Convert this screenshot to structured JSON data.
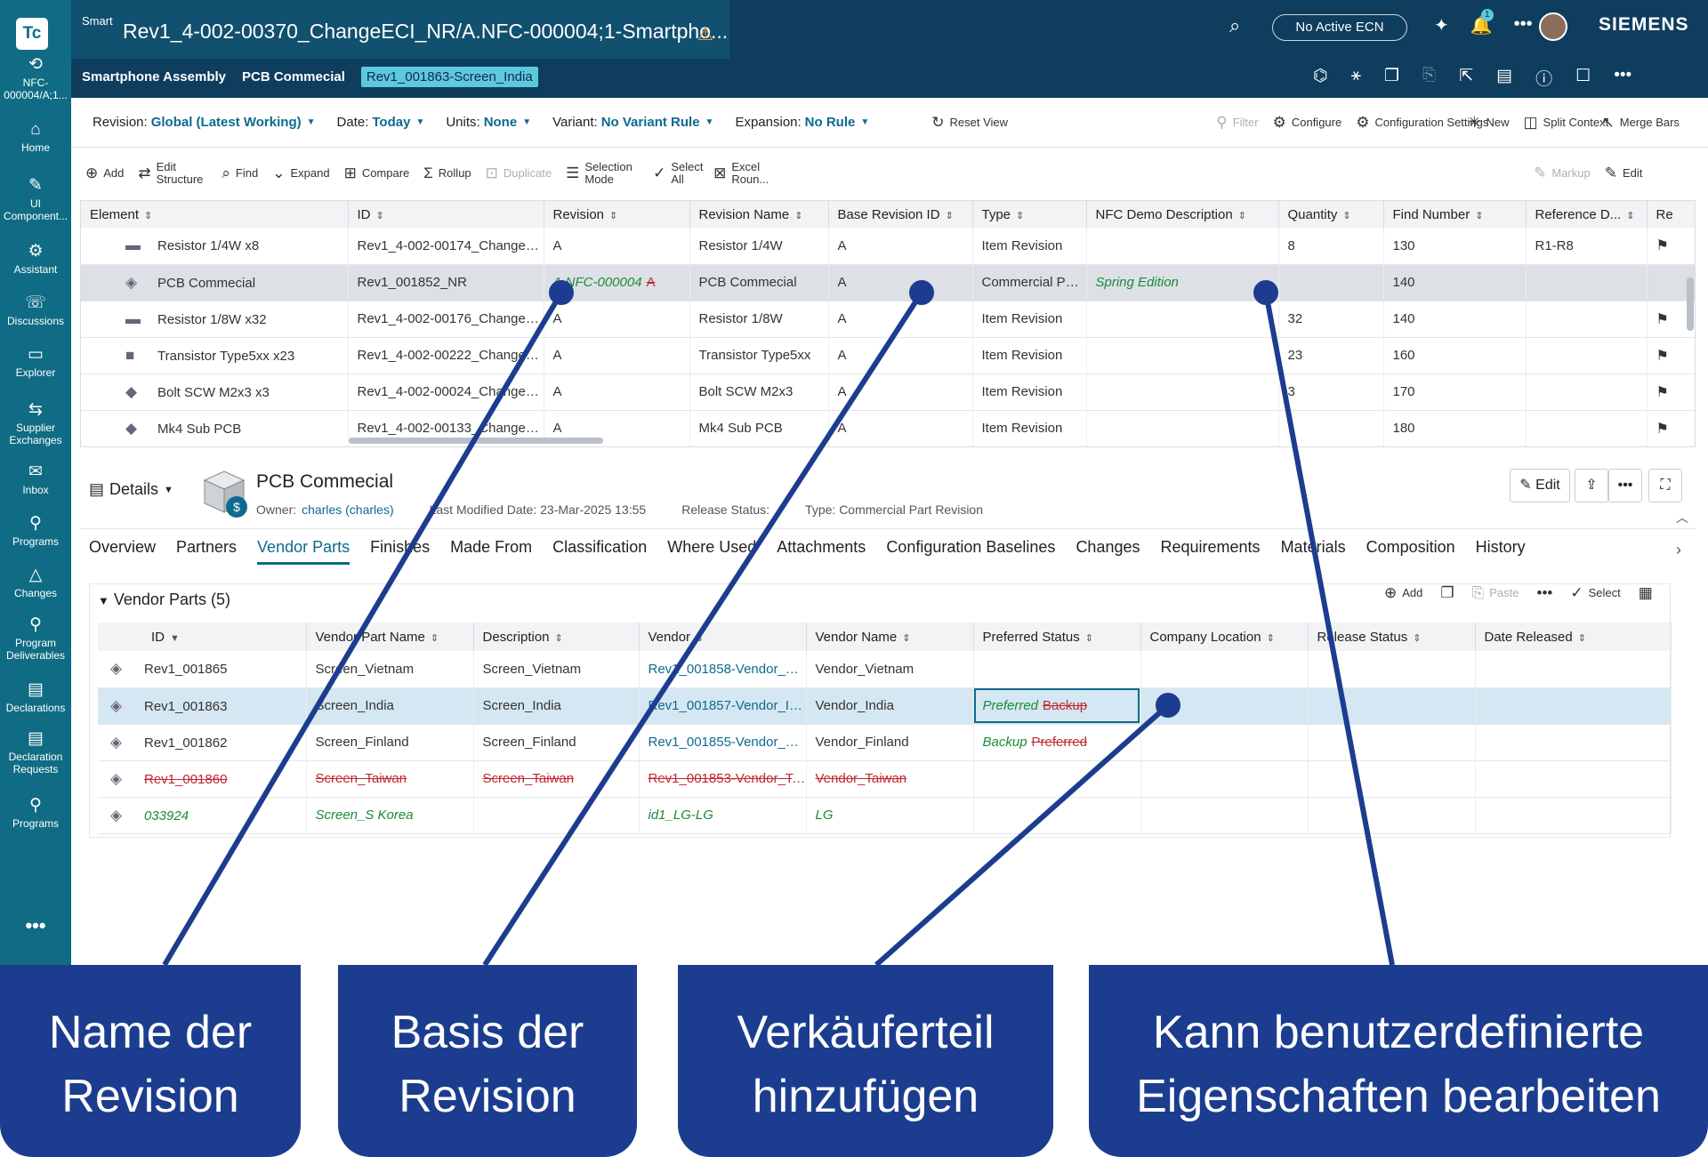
{
  "app": {
    "logo": "Tc",
    "window_title": "Rev1_4-002-00370_ChangeECI_NR/A.NFC-000004;1-Smartpho...",
    "smart_label": "Smart",
    "ecn_badge": "No Active ECN",
    "notification_count": "1",
    "brand": "SIEMENS"
  },
  "breadcrumb": {
    "items": [
      "Smartphone Assembly",
      "PCB Commecial"
    ],
    "current": "Rev1_001863-Screen_India"
  },
  "rail": {
    "items": [
      {
        "label": "NFC-000004/A;1...",
        "icon": "refresh-icon"
      },
      {
        "label": "Home",
        "icon": "home-icon"
      },
      {
        "label": "UI Component...",
        "icon": "component-icon"
      },
      {
        "label": "Assistant",
        "icon": "assistant-icon"
      },
      {
        "label": "Discussions",
        "icon": "discussions-icon"
      },
      {
        "label": "Explorer",
        "icon": "explorer-icon"
      },
      {
        "label": "Supplier Exchanges",
        "icon": "supplier-icon"
      },
      {
        "label": "Inbox",
        "icon": "inbox-icon"
      },
      {
        "label": "Programs",
        "icon": "programs-icon"
      },
      {
        "label": "Changes",
        "icon": "changes-icon"
      },
      {
        "label": "Program Deliverables",
        "icon": "deliverables-icon"
      },
      {
        "label": "Declarations",
        "icon": "declarations-icon"
      },
      {
        "label": "Declaration Requests",
        "icon": "declaration-requests-icon"
      },
      {
        "label": "Programs",
        "icon": "programs-icon"
      }
    ],
    "more": "•••"
  },
  "context": {
    "revision_label": "Revision:",
    "revision_value": "Global (Latest Working)",
    "date_label": "Date:",
    "date_value": "Today",
    "units_label": "Units:",
    "units_value": "None",
    "variant_label": "Variant:",
    "variant_value": "No Variant Rule",
    "expansion_label": "Expansion:",
    "expansion_value": "No Rule",
    "reset_view": "Reset View",
    "filter": "Filter",
    "configure": "Configure",
    "configuration_settings": "Configuration Settings",
    "new": "New",
    "split_context": "Split Context",
    "merge_bars": "Merge Bars"
  },
  "toolbar": {
    "add": "Add",
    "edit_structure": "Edit Structure",
    "find": "Find",
    "expand": "Expand",
    "compare": "Compare",
    "rollup": "Rollup",
    "duplicate": "Duplicate",
    "selection_mode": "Selection Mode",
    "select_all": "Select All",
    "excel": "Excel Roun...",
    "markup": "Markup",
    "edit": "Edit"
  },
  "grid": {
    "columns": [
      "Element",
      "ID",
      "Revision",
      "Revision Name",
      "Base Revision ID",
      "Type",
      "NFC Demo Description",
      "Quantity",
      "Find Number",
      "Reference D...",
      "Re"
    ],
    "rows": [
      {
        "element": "Resistor 1/4W x8",
        "id": "Rev1_4-002-00174_ChangeE...",
        "revision": "A",
        "rev_name": "Resistor 1/4W",
        "base": "A",
        "type": "Item Revision",
        "nfc": "",
        "qty": "8",
        "find": "130",
        "ref": "R1-R8",
        "flag": true
      },
      {
        "element": "PCB Commecial",
        "id": "Rev1_001852_NR",
        "revision": "A.NFC-000004",
        "rev_strike": "A",
        "rev_name": "PCB Commecial",
        "base": "A",
        "type": "Commercial Par...",
        "nfc": "Spring Edition",
        "qty": "",
        "find": "140",
        "ref": "",
        "flag": false,
        "selected": true
      },
      {
        "element": "Resistor 1/8W x32",
        "id": "Rev1_4-002-00176_ChangeE...",
        "revision": "A",
        "rev_name": "Resistor 1/8W",
        "base": "A",
        "type": "Item Revision",
        "nfc": "",
        "qty": "32",
        "find": "140",
        "ref": "",
        "flag": true
      },
      {
        "element": "Transistor Type5xx x23",
        "id": "Rev1_4-002-00222_ChangeE...",
        "revision": "A",
        "rev_name": "Transistor Type5xx",
        "base": "A",
        "type": "Item Revision",
        "nfc": "",
        "qty": "23",
        "find": "160",
        "ref": "",
        "flag": true
      },
      {
        "element": "Bolt SCW M2x3 x3",
        "id": "Rev1_4-002-00024_ChangeE...",
        "revision": "A",
        "rev_name": "Bolt SCW M2x3",
        "base": "A",
        "type": "Item Revision",
        "nfc": "",
        "qty": "3",
        "find": "170",
        "ref": "",
        "flag": true
      },
      {
        "element": "Mk4 Sub PCB",
        "id": "Rev1_4-002-00133_ChangeE...",
        "revision": "A",
        "rev_name": "Mk4 Sub PCB",
        "base": "A",
        "type": "Item Revision",
        "nfc": "",
        "qty": "",
        "find": "180",
        "ref": "",
        "flag": true
      }
    ]
  },
  "details": {
    "label": "Details",
    "name": "PCB Commecial",
    "owner_label": "Owner:",
    "owner": "charles (charles)",
    "modified_label": "Last Modified Date:",
    "modified": "23-Mar-2025 13:55",
    "release_label": "Release Status:",
    "type_label": "Type:",
    "type": "Commercial Part Revision",
    "edit": "Edit"
  },
  "tabs": [
    "Overview",
    "Partners",
    "Vendor Parts",
    "Finishes",
    "Made From",
    "Classification",
    "Where Used",
    "Attachments",
    "Configuration Baselines",
    "Changes",
    "Requirements",
    "Materials",
    "Composition",
    "History"
  ],
  "active_tab": "Vendor Parts",
  "vendor_parts": {
    "title": "Vendor Parts (5)",
    "add": "Add",
    "paste": "Paste",
    "select": "Select",
    "columns": [
      "ID",
      "Vendor Part Name",
      "Description",
      "Vendor",
      "Vendor Name",
      "Preferred Status",
      "Company Location",
      "Release Status",
      "Date Released"
    ],
    "rows": [
      {
        "id": "Rev1_001865",
        "part": "Screen_Vietnam",
        "desc": "Screen_Vietnam",
        "vendor": "Rev1_001858-Vendor_Vi...",
        "vname": "Vendor_Vietnam",
        "pref": "",
        "pref_strike": "",
        "style": "normal"
      },
      {
        "id": "Rev1_001863",
        "part": "Screen_India",
        "desc": "Screen_India",
        "vendor": "Rev1_001857-Vendor_In...",
        "vname": "Vendor_India",
        "pref": "Preferred",
        "pref_strike": "Backup",
        "style": "selected"
      },
      {
        "id": "Rev1_001862",
        "part": "Screen_Finland",
        "desc": "Screen_Finland",
        "vendor": "Rev1_001855-Vendor_Fi...",
        "vname": "Vendor_Finland",
        "pref": "Backup",
        "pref_strike": "Preferred",
        "style": "normal"
      },
      {
        "id": "Rev1_001860",
        "part": "Screen_Taiwan",
        "desc": "Screen_Taiwan",
        "vendor": "Rev1_001853-Vendor_Ta...",
        "vname": "Vendor_Taiwan",
        "pref": "",
        "pref_strike": "",
        "style": "deleted"
      },
      {
        "id": "033924",
        "part": "Screen_S Korea",
        "desc": "",
        "vendor": "id1_LG-LG",
        "vname": "LG",
        "pref": "",
        "pref_strike": "",
        "style": "added"
      }
    ]
  },
  "captions": [
    "Name der Revision",
    "Basis der Revision",
    "Verkäuferteil hinzufügen",
    "Kann benutzerdefinierte Eigenschaften bearbeiten"
  ],
  "colors": {
    "accent": "#0e6a8f",
    "rail": "#0f6c84",
    "topbar": "#0e3d5e",
    "caption": "#1c3d8f",
    "added": "#1b8a3a",
    "removed": "#c0282f"
  }
}
